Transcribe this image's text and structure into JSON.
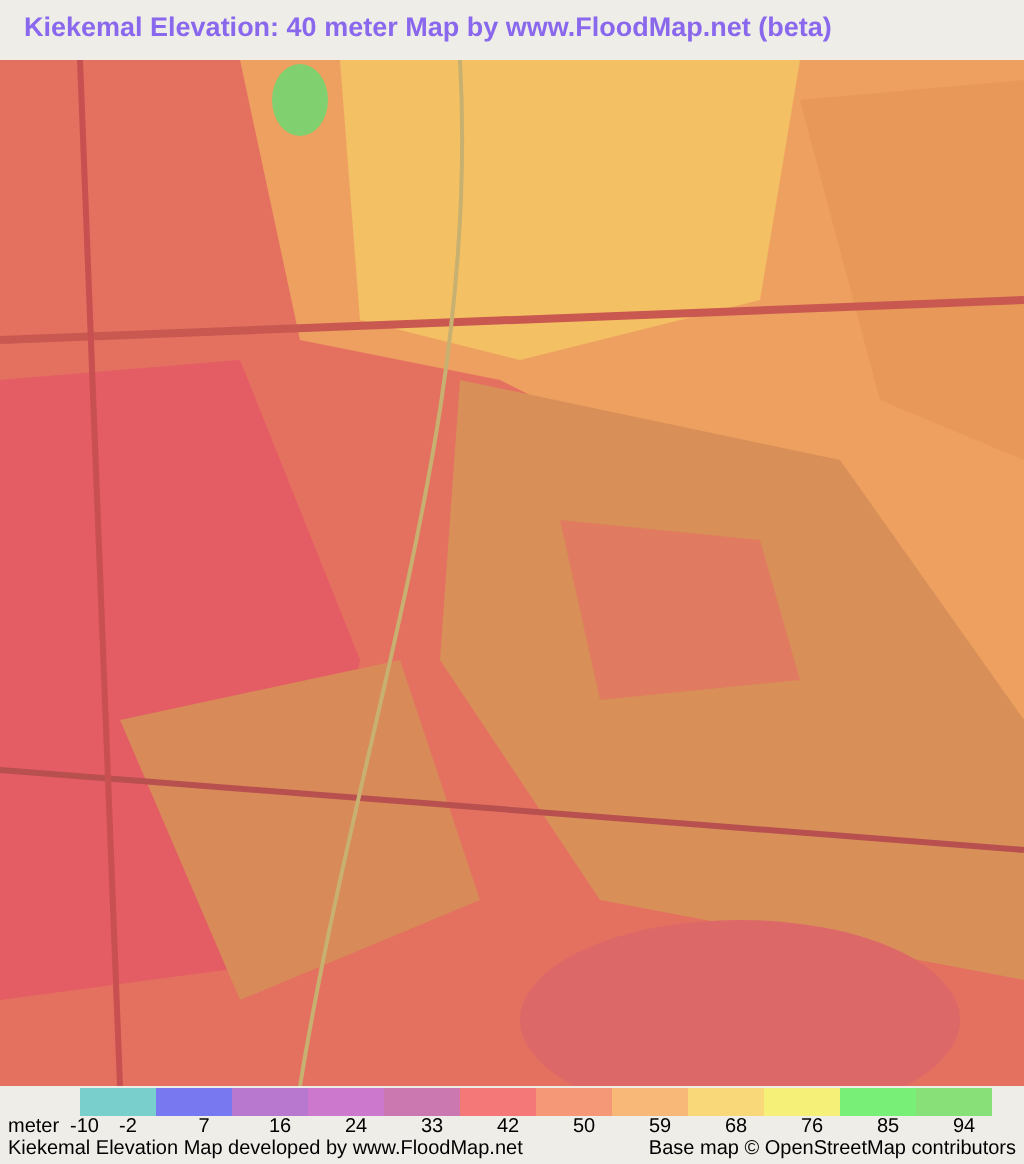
{
  "title": "Kiekemal Elevation: 40 meter Map by www.FloodMap.net (beta)",
  "legend": {
    "unit": "meter",
    "swatches": [
      {
        "color": "#78cfcc"
      },
      {
        "color": "#7878f0"
      },
      {
        "color": "#b878d0"
      },
      {
        "color": "#cc78cc"
      },
      {
        "color": "#cc78b0"
      },
      {
        "color": "#f57878"
      },
      {
        "color": "#f59878"
      },
      {
        "color": "#f8b878"
      },
      {
        "color": "#f8d878"
      },
      {
        "color": "#f5f078"
      },
      {
        "color": "#78f078"
      },
      {
        "color": "#88e078"
      }
    ],
    "labels": [
      "-10",
      "-2",
      "7",
      "16",
      "24",
      "33",
      "42",
      "50",
      "59",
      "68",
      "76",
      "85",
      "94"
    ]
  },
  "footer": {
    "credit": "Kiekemal Elevation Map developed by www.FloodMap.net",
    "attribution": "Base map © OpenStreetMap contributors"
  }
}
